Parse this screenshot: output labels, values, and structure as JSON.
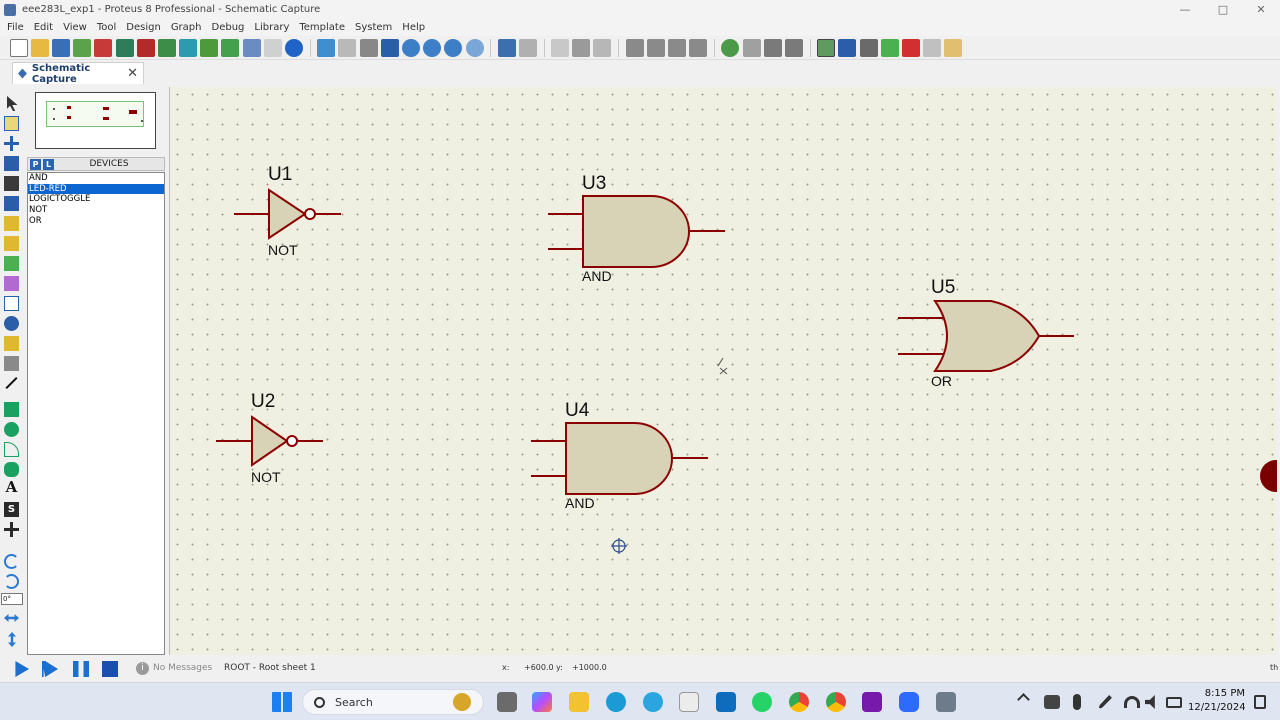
{
  "window": {
    "title": "eee283L_exp1 - Proteus 8 Professional - Schematic Capture"
  },
  "menu": [
    "File",
    "Edit",
    "View",
    "Tool",
    "Design",
    "Graph",
    "Debug",
    "Library",
    "Template",
    "System",
    "Help"
  ],
  "tab": {
    "label": "Schematic Capture"
  },
  "devices": {
    "p_button": "P",
    "l_button": "L",
    "header": "DEVICES",
    "items": [
      "AND",
      "LED-RED",
      "LOGICTOGGLE",
      "NOT",
      "OR"
    ],
    "selected_index": 1
  },
  "left_tools": {
    "angle_value": "0°"
  },
  "schematic": {
    "components": [
      {
        "ref": "U1",
        "type": "NOT"
      },
      {
        "ref": "U2",
        "type": "NOT"
      },
      {
        "ref": "U3",
        "type": "AND"
      },
      {
        "ref": "U4",
        "type": "AND"
      },
      {
        "ref": "U5",
        "type": "OR"
      }
    ],
    "wire_color": "#8b0000",
    "body_color": "#d8d3b6"
  },
  "status": {
    "messages": "No Messages",
    "sheet": "ROOT - Root sheet 1",
    "x_label": "x:",
    "x_value": "+600.0",
    "y_label": "y:",
    "y_value": "+1000.0",
    "edge": "th"
  },
  "taskbar": {
    "search": "Search",
    "time": "8:15 PM",
    "date": "12/21/2024"
  }
}
